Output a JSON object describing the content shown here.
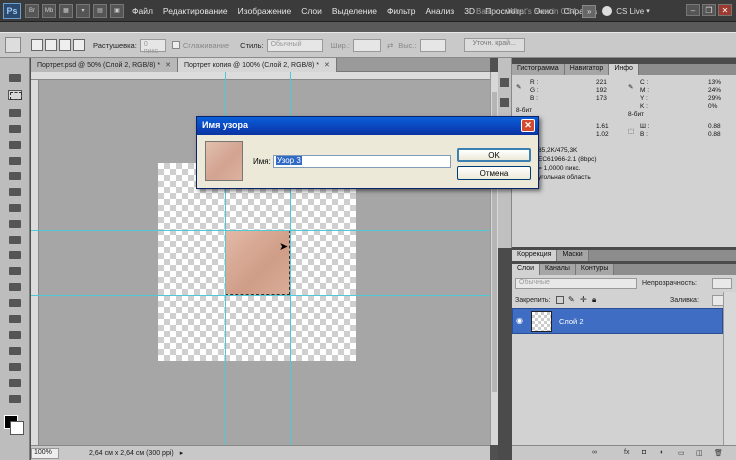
{
  "menubar": {
    "logo": "Ps",
    "mini_buttons": [
      "Br",
      "Mb"
    ],
    "items": [
      "Файл",
      "Редактирование",
      "Изображение",
      "Слои",
      "Выделение",
      "Фильтр",
      "Анализ",
      "3D",
      "Просмотр",
      "Окно",
      "Справка"
    ],
    "workspace_items": [
      "Basic",
      "What's New in CS4"
    ],
    "cs_live": "CS Live"
  },
  "options": {
    "feather_label": "Растушевка:",
    "feather_value": "0 пикс",
    "antialias_label": "Сглаживание",
    "style_label": "Стиль:",
    "style_value": "Обычный",
    "width_label": "Шир.:",
    "height_label": "Выс.:",
    "refine_label": "Уточн. край..."
  },
  "tabs": [
    {
      "label": "Портрет.psd @ 50% (Слой 2, RGB/8) *",
      "active": false
    },
    {
      "label": "Портрет копия @ 100% (Слой 2, RGB/8) *",
      "active": true
    }
  ],
  "status": {
    "zoom": "100%",
    "info": "2,64 см x 2,64 см (300 ppi)"
  },
  "info_panel": {
    "tabs": [
      "Гистограмма",
      "Навигатор",
      "Инфо"
    ],
    "rgb_labels": [
      "R :",
      "G :",
      "B :"
    ],
    "rgb_values": [
      "221",
      "192",
      "173"
    ],
    "cmyk_labels": [
      "C :",
      "M :",
      "Y :",
      "K :"
    ],
    "cmyk_values": [
      "13%",
      "24%",
      "29%",
      "0%"
    ],
    "bit_left": "8-бит",
    "bit_right": "8-бит",
    "xy_labels": [
      "X :",
      "Y :"
    ],
    "xy_values": [
      "1.61",
      "1.02"
    ],
    "wh_labels": [
      "Ш :",
      "В :"
    ],
    "wh_values": [
      "0.88",
      "0.88"
    ],
    "doc_lines": [
      "85,2K/475,3K",
      "EC61966-2.1 (8bpc)",
      "= 1,0000 пикс.",
      "угольная область"
    ]
  },
  "adjust_tabs": [
    "Коррекция",
    "Маски"
  ],
  "layers": {
    "tabs": [
      "Слои",
      "Каналы",
      "Контуры"
    ],
    "blend_mode": "Обычные",
    "opacity_label": "Непрозрачность:",
    "lock_label": "Закрепить:",
    "fill_label": "Заливка:",
    "layer_name": "Слой 2"
  },
  "dialog": {
    "title": "Имя узора",
    "name_label": "Имя:",
    "name_value": "Узор 3",
    "ok_label": "OK",
    "cancel_label": "Отмена",
    "close_glyph": "✕"
  }
}
